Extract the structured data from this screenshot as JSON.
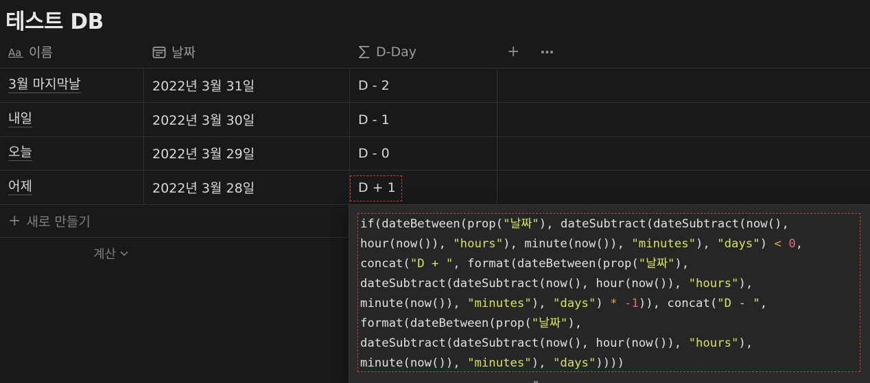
{
  "db_title": "테스트 DB",
  "columns": [
    {
      "label": "이름",
      "icon": "text-type-icon"
    },
    {
      "label": "날짜",
      "icon": "calendar-icon"
    },
    {
      "label": "D-Day",
      "icon": "sigma-formula-icon"
    }
  ],
  "header_actions": {
    "add": "+",
    "more": "···"
  },
  "rows": [
    {
      "name": "3월 마지막날",
      "date": "2022년 3월 31일",
      "dday": "D - 2"
    },
    {
      "name": "내일",
      "date": "2022년 3월 30일",
      "dday": "D - 1"
    },
    {
      "name": "오늘",
      "date": "2022년 3월 29일",
      "dday": "D - 0"
    },
    {
      "name": "어제",
      "date": "2022년 3월 28일",
      "dday": "D + 1"
    }
  ],
  "new_row_label": "새로 만들기",
  "calculate_label": "계산",
  "formula": {
    "code": "if(dateBetween(prop(\"날짜\"), dateSubtract(dateSubtract(now(), hour(now()), \"hours\"), minute(now()), \"minutes\"), \"days\") < 0, concat(\"D + \", format(dateBetween(prop(\"날짜\"), dateSubtract(dateSubtract(now(), hour(now()), \"hours\"), minute(now()), \"minutes\"), \"days\") * -1)), concat(\"D - \", format(dateBetween(prop(\"날짜\"), dateSubtract(dateSubtract(now(), hour(now()), \"hours\"), minute(now()), \"minutes\"), \"days\"))))",
    "lines": [
      "if(dateBetween(prop(\"날짜\"), dateSubtract(dateSubtract(now(),",
      "hour(now()), \"hours\"), minute(now()), \"minutes\"), \"days\") < 0,",
      "concat(\"D + \", format(dateBetween(prop(\"날짜\"),",
      "dateSubtract(dateSubtract(now(), hour(now()), \"hours\"),",
      "minute(now()), \"minutes\"), \"days\") * -1)), concat(\"D - \",",
      "format(dateBetween(prop(\"날짜\"),",
      "dateSubtract(dateSubtract(now(), hour(now()), \"hours\"),",
      "minute(now()), \"minutes\"), \"days\"))))"
    ]
  },
  "colors": {
    "background": "#191919",
    "string": "#d7e35a",
    "number": "#e06c75",
    "operator": "#e3a54a",
    "highlight_border": "#d93a3a"
  }
}
